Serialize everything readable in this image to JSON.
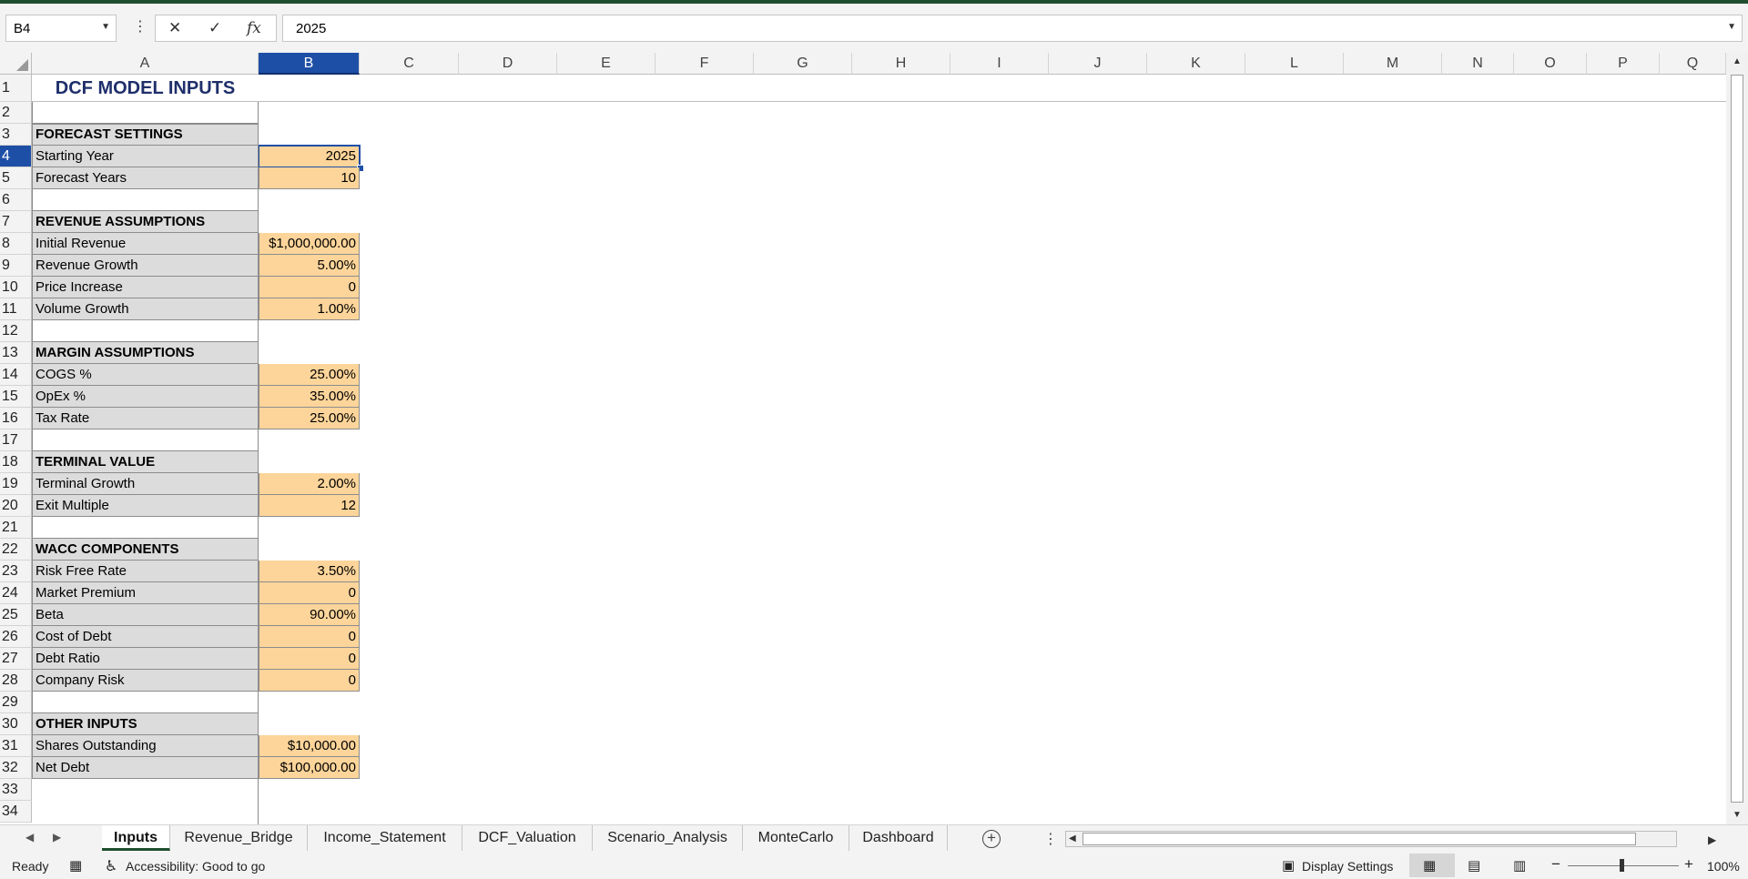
{
  "formula_bar": {
    "name_box": "B4",
    "cancel_icon": "✕",
    "enter_icon": "✓",
    "function_icon": "fx",
    "content": "2025"
  },
  "columns": [
    "A",
    "B",
    "C",
    "D",
    "E",
    "F",
    "G",
    "H",
    "I",
    "J",
    "K",
    "L",
    "M",
    "N",
    "O",
    "P",
    "Q"
  ],
  "selected_column": "B",
  "selected_row": "4",
  "title": "DCF MODEL INPUTS",
  "rows": [
    {
      "n": "1",
      "label": "",
      "value": "",
      "kind": "title"
    },
    {
      "n": "2",
      "label": "",
      "value": "",
      "kind": "blank"
    },
    {
      "n": "3",
      "label": "FORECAST SETTINGS",
      "value": "",
      "kind": "header"
    },
    {
      "n": "4",
      "label": "Starting Year",
      "value": "2025",
      "kind": "input"
    },
    {
      "n": "5",
      "label": "Forecast Years",
      "value": "10",
      "kind": "input"
    },
    {
      "n": "6",
      "label": "",
      "value": "",
      "kind": "blank"
    },
    {
      "n": "7",
      "label": "REVENUE ASSUMPTIONS",
      "value": "",
      "kind": "header"
    },
    {
      "n": "8",
      "label": "Initial Revenue",
      "value": "$1,000,000.00",
      "kind": "input"
    },
    {
      "n": "9",
      "label": "Revenue Growth",
      "value": "5.00%",
      "kind": "input"
    },
    {
      "n": "10",
      "label": "Price Increase",
      "value": "0",
      "kind": "input"
    },
    {
      "n": "11",
      "label": "Volume Growth",
      "value": "1.00%",
      "kind": "input"
    },
    {
      "n": "12",
      "label": "",
      "value": "",
      "kind": "blank"
    },
    {
      "n": "13",
      "label": "MARGIN ASSUMPTIONS",
      "value": "",
      "kind": "header"
    },
    {
      "n": "14",
      "label": "COGS %",
      "value": "25.00%",
      "kind": "input"
    },
    {
      "n": "15",
      "label": "OpEx %",
      "value": "35.00%",
      "kind": "input"
    },
    {
      "n": "16",
      "label": "Tax Rate",
      "value": "25.00%",
      "kind": "input"
    },
    {
      "n": "17",
      "label": "",
      "value": "",
      "kind": "blank"
    },
    {
      "n": "18",
      "label": "TERMINAL VALUE",
      "value": "",
      "kind": "header"
    },
    {
      "n": "19",
      "label": "Terminal Growth",
      "value": "2.00%",
      "kind": "input"
    },
    {
      "n": "20",
      "label": "Exit Multiple",
      "value": "12",
      "kind": "input"
    },
    {
      "n": "21",
      "label": "",
      "value": "",
      "kind": "blank"
    },
    {
      "n": "22",
      "label": "WACC COMPONENTS",
      "value": "",
      "kind": "header"
    },
    {
      "n": "23",
      "label": "Risk Free Rate",
      "value": "3.50%",
      "kind": "input"
    },
    {
      "n": "24",
      "label": "Market Premium",
      "value": "0",
      "kind": "input"
    },
    {
      "n": "25",
      "label": "Beta",
      "value": "90.00%",
      "kind": "input"
    },
    {
      "n": "26",
      "label": "Cost of Debt",
      "value": "0",
      "kind": "input"
    },
    {
      "n": "27",
      "label": "Debt Ratio",
      "value": "0",
      "kind": "input"
    },
    {
      "n": "28",
      "label": "Company Risk",
      "value": "0",
      "kind": "input"
    },
    {
      "n": "29",
      "label": "",
      "value": "",
      "kind": "blank"
    },
    {
      "n": "30",
      "label": "OTHER INPUTS",
      "value": "",
      "kind": "header"
    },
    {
      "n": "31",
      "label": "Shares Outstanding",
      "value": "$10,000.00",
      "kind": "input"
    },
    {
      "n": "32",
      "label": "Net Debt",
      "value": "$100,000.00",
      "kind": "input"
    },
    {
      "n": "33",
      "label": "",
      "value": "",
      "kind": "empty"
    },
    {
      "n": "34",
      "label": "",
      "value": "",
      "kind": "empty"
    }
  ],
  "sheet_tabs": [
    "Inputs",
    "Revenue_Bridge",
    "Income_Statement",
    "DCF_Valuation",
    "Scenario_Analysis",
    "MonteCarlo",
    "Dashboard"
  ],
  "active_tab": "Inputs",
  "status_bar": {
    "ready": "Ready",
    "accessibility": "Accessibility: Good to go",
    "display_settings": "Display Settings",
    "zoom": "100%"
  },
  "colors": {
    "input_fill": "#fdd59a",
    "label_fill": "#dcdcdc",
    "title_color": "#1f2f6b",
    "selection": "#1e4fa6",
    "excel_green": "#1e4e2e"
  }
}
